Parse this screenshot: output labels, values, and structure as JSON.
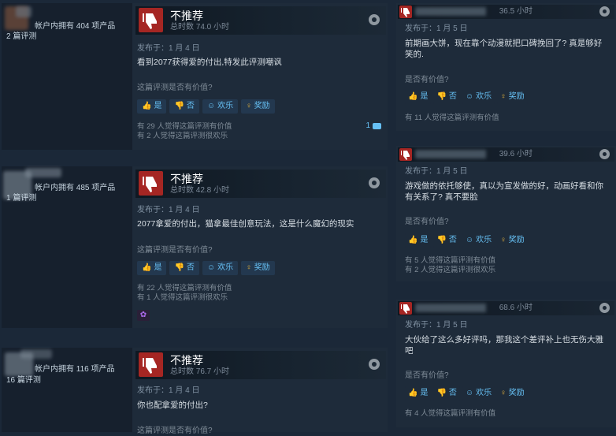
{
  "common": {
    "verdict": "不推荐",
    "helpful_question": "这篇评测是否有价值?",
    "helpful_question_short": "是否有价值?",
    "yes": "是",
    "no": "否",
    "funny": "欢乐",
    "award": "奖励"
  },
  "left_reviews": [
    {
      "owns": "帐户内拥有 404 项产品",
      "review_count": "2 篇评测",
      "hours": "总时数 74.0 小时",
      "posted": "发布于：1 月 4 日",
      "text": "看到2077获得爱的付出,特发此评测嘲讽",
      "helpful_stat": "有 29 人觉得这篇评测有价值",
      "funny_stat": "有 2 人觉得这篇评测很欢乐",
      "comments": "1"
    },
    {
      "owns": "帐户内拥有 485 项产品",
      "review_count": "1 篇评测",
      "hours": "总时数 42.8 小时",
      "posted": "发布于：1 月 4 日",
      "text": "2077拿爱的付出，猫拿最佳创意玩法，这是什么魔幻的现实",
      "helpful_stat": "有 22 人觉得这篇评测有价值",
      "funny_stat": "有 1 人觉得这篇评测很欢乐"
    },
    {
      "owns": "帐户内拥有 116 项产品",
      "review_count": "16 篇评测",
      "hours": "总时数 76.7 小时",
      "posted": "发布于：1 月 4 日",
      "text": "你也配拿爱的付出?",
      "helpful_question_partial": "这篇评测是否有价值?"
    }
  ],
  "right_reviews": [
    {
      "hours": "36.5 小时",
      "posted": "发布于：1 月 5 日",
      "text": "前期画大饼，现在靠个动漫就把口碑挽回了? 真是够好笑的.",
      "helpful_stat": "有 11 人觉得这篇评测有价值"
    },
    {
      "hours": "39.6 小时",
      "posted": "发布于：1 月 5 日",
      "text": "游戏做的依托够使，真以为宣发做的好，动画好看和你有关系了? 真不要脸",
      "helpful_stat": "有 5 人觉得这篇评测有价值",
      "funny_stat": "有 2 人觉得这篇评测很欢乐"
    },
    {
      "hours": "68.6 小时",
      "posted": "发布于：1 月 5 日",
      "text": "大伙给了这么多好评吗，那我这个差评补上也无伤大雅吧",
      "helpful_stat": "有 4 人觉得这篇评测有价值"
    }
  ],
  "colors": {
    "background": "#1b2838",
    "not_recommended": "#a52623",
    "link_blue": "#66c0f4"
  }
}
